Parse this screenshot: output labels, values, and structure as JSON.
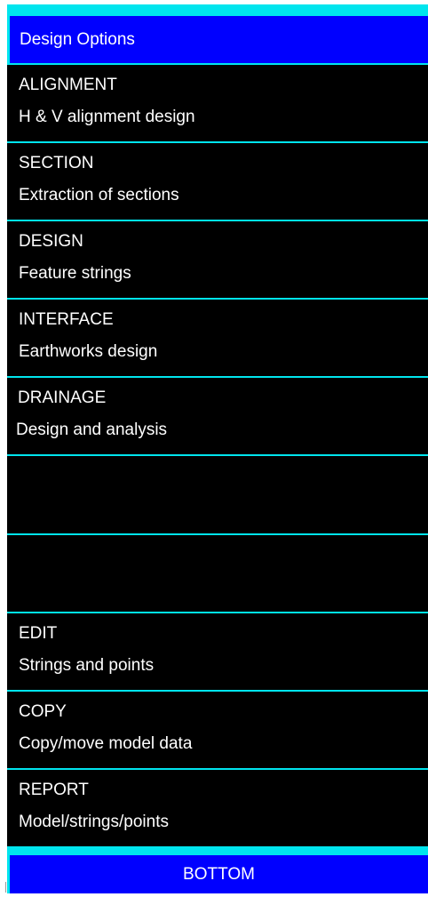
{
  "panel": {
    "title": "Design Options",
    "options": [
      {
        "label": "ALIGNMENT",
        "description": "H & V alignment design"
      },
      {
        "label": "SECTION",
        "description": "Extraction of sections"
      },
      {
        "label": "DESIGN",
        "description": "Feature strings"
      },
      {
        "label": "INTERFACE",
        "description": "Earthworks design"
      },
      {
        "label": "DRAINAGE",
        "description": "Design and analysis"
      },
      {
        "label": "EDIT",
        "description": "Strings and points"
      },
      {
        "label": "COPY",
        "description": "Copy/move model data"
      },
      {
        "label": "REPORT",
        "description": "Model/strings/points"
      }
    ],
    "bottom_label": "BOTTOM"
  },
  "colors": {
    "background": "#00e5ee",
    "header": "#0000ff",
    "option_background": "#000000",
    "text": "#ffffff"
  }
}
